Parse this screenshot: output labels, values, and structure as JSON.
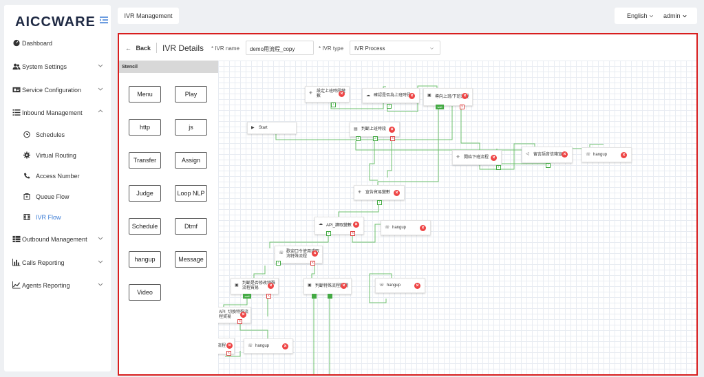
{
  "logo": "AICCWARE",
  "top_tab": "IVR Management",
  "lang": "English",
  "user": "admin",
  "sidebar": [
    {
      "label": "Dashboard",
      "icon": "dashboard-icon"
    },
    {
      "label": "System Settings",
      "icon": "users-icon"
    },
    {
      "label": "Service Configuration",
      "icon": "id-card-icon"
    },
    {
      "label": "Inbound Management",
      "icon": "list-icon"
    },
    {
      "label": "Schedules",
      "icon": "clock-icon"
    },
    {
      "label": "Virtual Routing",
      "icon": "gear-icon"
    },
    {
      "label": "Access Number",
      "icon": "phone-icon"
    },
    {
      "label": "Queue Flow",
      "icon": "queue-icon"
    },
    {
      "label": "IVR Flow",
      "icon": "film-icon"
    },
    {
      "label": "Outbound Management",
      "icon": "table-icon"
    },
    {
      "label": "Calls Reporting",
      "icon": "bar-chart-icon"
    },
    {
      "label": "Agents Reporting",
      "icon": "line-chart-icon"
    }
  ],
  "header": {
    "back": "Back",
    "title": "IVR Details",
    "name_label": "* IVR name",
    "name_value": "demo用流程_copy",
    "type_label": "* IVR type",
    "type_value": "IVR Process"
  },
  "stencil": {
    "title": "Stencil",
    "items": [
      "Menu",
      "Play",
      "http",
      "js",
      "Transfer",
      "Assign",
      "Judge",
      "Loop NLP",
      "Schedule",
      "Dtmf",
      "hangup",
      "Message",
      "Video"
    ]
  },
  "nodes": {
    "n1": "設定上班時段變數",
    "n2": "確認是否為上班時段",
    "n3": "導向上班/下班流程",
    "start": "Start",
    "n4": "判斷上班時段",
    "n5": "開始下班流程",
    "n6": "留言語音信箱宣告",
    "h1": "hangup",
    "n7": "宣告貿易變數",
    "n8": "API_讀取變數",
    "h2": "hangup",
    "n9": "歡迎口令使用或取消特殊流程",
    "n10": "判斷是否修改特殊流程貿易",
    "n11": "判斷特殊流程開關",
    "h3": "hangup",
    "n12": "API_切換特殊流程貿易",
    "n13": "流程",
    "h4": "hangup"
  }
}
